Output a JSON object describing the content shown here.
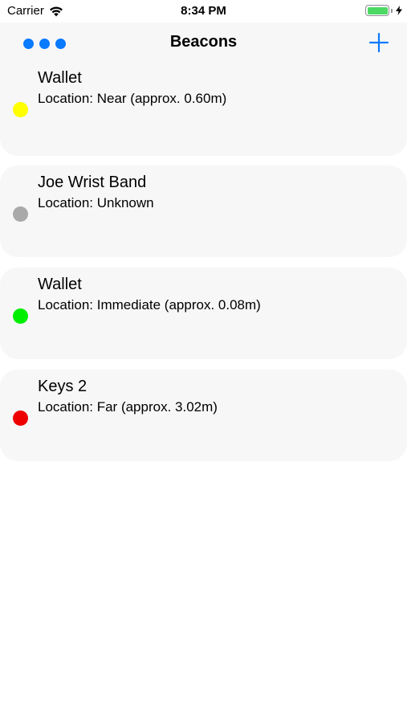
{
  "status_bar": {
    "carrier": "Carrier",
    "time": "8:34 PM",
    "battery_level": 1.0
  },
  "nav": {
    "title": "Beacons",
    "more_icon": "ellipsis-icon",
    "add_icon": "plus-icon",
    "accent_color": "#0a7aff"
  },
  "beacons": [
    {
      "name": "Wallet",
      "location": "Location: Near (approx. 0.60m)",
      "status_color": "#ffff00"
    },
    {
      "name": "Joe Wrist Band",
      "location": "Location: Unknown",
      "status_color": "#a9a9a9"
    },
    {
      "name": "Wallet",
      "location": "Location: Immediate (approx. 0.08m)",
      "status_color": "#00ee00"
    },
    {
      "name": "Keys 2",
      "location": "Location: Far (approx. 3.02m)",
      "status_color": "#ee0000"
    }
  ]
}
